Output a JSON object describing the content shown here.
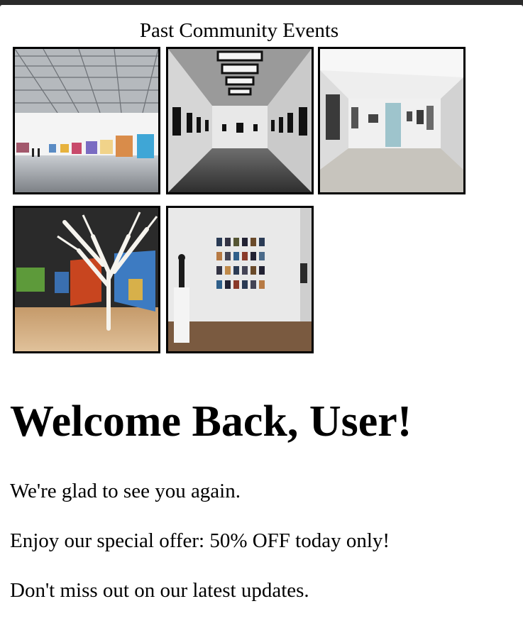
{
  "gallery": {
    "title": "Past Community Events",
    "images": [
      {
        "description": "gallery-hall-skylight-truss"
      },
      {
        "description": "gallery-corridor-framed-prints"
      },
      {
        "description": "gallery-white-hall-bright-floor"
      },
      {
        "description": "gallery-white-tree-sculpture"
      },
      {
        "description": "gallery-photo-grid-wall-statue"
      }
    ]
  },
  "welcome": {
    "heading": "Welcome Back, User!",
    "line1": "We're glad to see you again.",
    "line2": "Enjoy our special offer: 50% OFF today only!",
    "line3": "Don't miss out on our latest updates."
  }
}
